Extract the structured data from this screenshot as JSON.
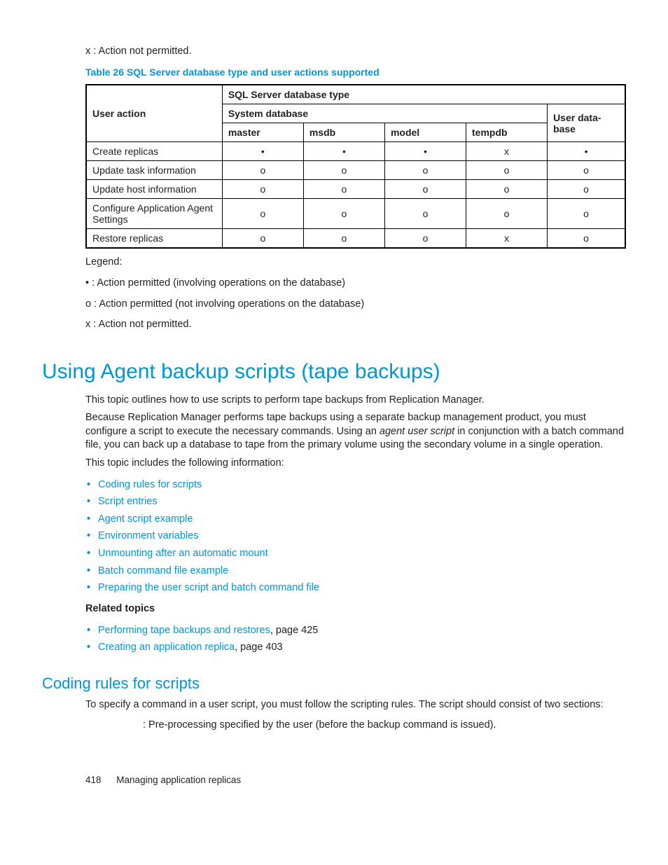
{
  "top_note": "x : Action not permitted.",
  "table_caption": "Table 26 SQL Server database type and user actions supported",
  "table": {
    "col_group_user_action": "User action",
    "col_group_sql_type": "SQL Server database type",
    "col_group_sys_db": "System database",
    "col_group_user_db": "User data-base",
    "sub_cols": [
      "master",
      "msdb",
      "model",
      "tempdb"
    ],
    "rows": [
      {
        "label": "Create replicas",
        "cells": [
          "•",
          "•",
          "•",
          "x",
          "•"
        ]
      },
      {
        "label": "Update task information",
        "cells": [
          "o",
          "o",
          "o",
          "o",
          "o"
        ]
      },
      {
        "label": "Update host information",
        "cells": [
          "o",
          "o",
          "o",
          "o",
          "o"
        ]
      },
      {
        "label": "Configure Application Agent Settings",
        "cells": [
          "o",
          "o",
          "o",
          "o",
          "o"
        ]
      },
      {
        "label": "Restore replicas",
        "cells": [
          "o",
          "o",
          "o",
          "x",
          "o"
        ]
      }
    ]
  },
  "legend": {
    "title": "Legend:",
    "items": [
      "• : Action permitted (involving operations on the database)",
      "o : Action permitted (not involving operations on the database)",
      "x : Action not permitted."
    ]
  },
  "h1": "Using Agent backup scripts (tape backups)",
  "intro_p1": "This topic outlines how to use scripts to perform tape backups from Replication Manager.",
  "intro_p2a": "Because Replication Manager performs tape backups using a separate backup management product, you must configure a script to execute the necessary commands. Using an ",
  "intro_p2_em": "agent user script",
  "intro_p2b": " in conjunction with a batch command file, you can back up a database to tape from the primary volume using the secondary volume in a single operation.",
  "intro_p3": "This topic includes the following information:",
  "toc_links": [
    "Coding rules for scripts",
    "Script entries",
    "Agent script example",
    "Environment variables",
    "Unmounting after an automatic mount",
    "Batch command file example",
    "Preparing the user script and batch command file"
  ],
  "related_heading": "Related topics",
  "related": [
    {
      "link": "Performing tape backups and restores",
      "suffix": ", page 425"
    },
    {
      "link": "Creating an application replica",
      "suffix": ", page 403"
    }
  ],
  "h2": "Coding rules for scripts",
  "rules_p1": "To specify a command in a user script, you must follow the scripting rules. The script should consist of two sections:",
  "def1": ": Pre-processing specified by the user (before the backup command is issued).",
  "footer_page": "418",
  "footer_text": "Managing application replicas"
}
